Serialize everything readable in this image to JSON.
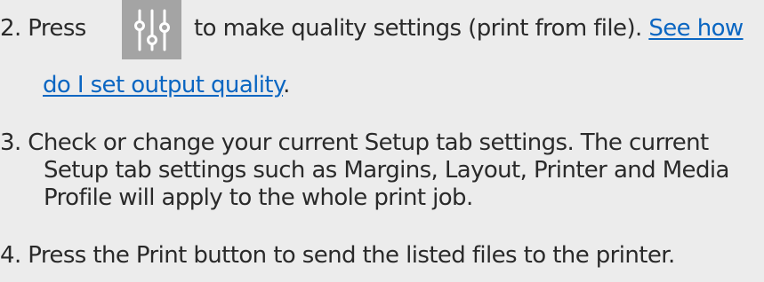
{
  "steps": [
    {
      "number": "2.",
      "text_before_icon": "Press",
      "icon": "quality-settings-sliders-icon",
      "text_after_icon": "to make quality settings (print from file).",
      "link_line1": "See how",
      "link_line2": " do I set output quality",
      "link_suffix": "."
    },
    {
      "number": "3.",
      "lines": [
        "Check or change your current Setup tab settings. The current",
        "Setup tab settings such as Margins, Layout, Printer and Media",
        "Profile will apply to the whole print job."
      ]
    },
    {
      "number": "4.",
      "lines": [
        "Press the Print button to send the listed files to the printer."
      ]
    }
  ],
  "colors": {
    "background": "#ececec",
    "text": "#2a2a2a",
    "link": "#0a66c2",
    "icon_button": "#a4a4a4"
  }
}
